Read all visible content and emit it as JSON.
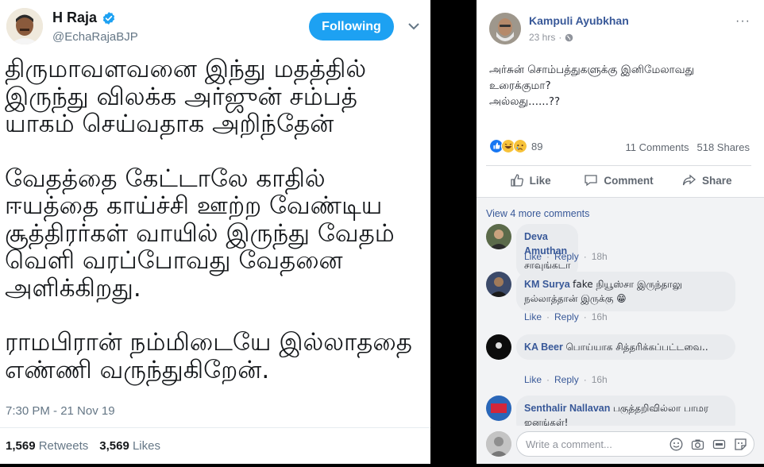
{
  "tweet": {
    "name": "H Raja",
    "handle": "@EchaRajaBJP",
    "follow_label": "Following",
    "paragraphs": [
      "திருமாவளவனை இந்து மதத்தில் இருந்து விலக்க அர்ஜுன் சம்பத் யாகம் செய்வதாக அறிந்தேன்",
      "வேதத்தை கேட்டாலே காதில் ஈயத்தை காய்ச்சி ஊற்ற வேண்டிய சூத்திரர்கள் வாயில் இருந்து வேதம் வெளி வரப்போவது வேதனை அளிக்கிறது.",
      "ராமபிரான் நம்மிடையே இல்லாததை எண்ணி வருந்துகிறேன்."
    ],
    "time": "7:30 PM - 21 Nov 19",
    "retweets_count": "1,569",
    "retweets_label": "Retweets",
    "likes_count": "3,569",
    "likes_label": "Likes",
    "colors": {
      "accent": "#1da1f2",
      "text": "#14171a",
      "muted": "#657786"
    }
  },
  "facebook": {
    "author": "Kampuli Ayubkhan",
    "time": "23 hrs",
    "more": "···",
    "post_line1": "அர்சுன் சொம்பத்துகளுக்கு இனிமேலாவது உரைக்குமா?",
    "post_line2": "அல்லது......??",
    "reactions_count": "89",
    "comments_count": "11 Comments",
    "shares_count": "518 Shares",
    "actions": {
      "like": "Like",
      "comment": "Comment",
      "share": "Share"
    },
    "view_more": "View 4 more comments",
    "comment_like": "Like",
    "comment_reply": "Reply",
    "comments": [
      {
        "author": "Deva Amuthan",
        "text": "சாவுங்கடா",
        "time": "18h"
      },
      {
        "author": "KM Surya",
        "text": "fake நியூஸ்சா இருந்தாலு நல்லாத்தான் இருக்கு 😁",
        "time": "16h"
      },
      {
        "author": "KA Beer",
        "text": "பொய்யாக சித்தரிக்கப்பட்டவை..",
        "time": "16h"
      },
      {
        "author": "Senthalir Nallavan",
        "text": "பகுத்தறிவில்லா பாமர ஜனங்கள்!"
      }
    ],
    "compose_placeholder": "Write a comment...",
    "colors": {
      "link": "#385898",
      "muted": "#90949c",
      "bubble": "#e9ebee"
    }
  }
}
